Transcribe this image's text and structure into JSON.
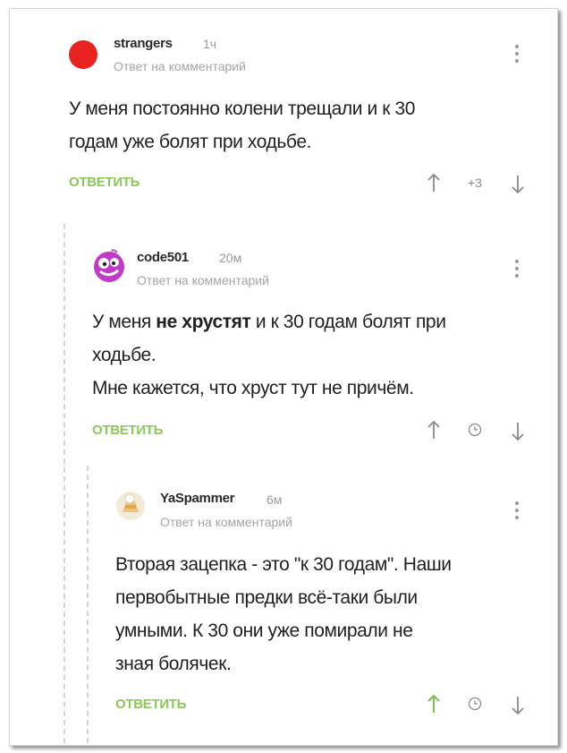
{
  "comments": [
    {
      "username": "strangers",
      "time": "1ч",
      "reply_to": "Ответ на комментарий",
      "text_lines": [
        "У меня постоянно колени трещали и к 30",
        "годам уже болят при ходьбе."
      ],
      "reply_label": "ОТВЕТИТЬ",
      "rating": "+3",
      "avatar_color": "#e8231f"
    },
    {
      "username": "code501",
      "time": "20м",
      "reply_to": "Ответ на комментарий",
      "text_parts": {
        "before": "У меня ",
        "bold": "не хрустят",
        "after": " и к 30 годам болят при",
        "line2": "ходьбе.",
        "line3": "Мне кажется, что хруст тут не причём."
      },
      "reply_label": "ОТВЕТИТЬ",
      "avatar_color": "#c13bc9"
    },
    {
      "username": "YaSpammer",
      "time": "6м",
      "reply_to": "Ответ на комментарий",
      "text_lines": [
        "Вторая зацепка - это \"к 30 годам\". Наши",
        "первобытные предки всё-таки были",
        "умными. К 30 они уже помирали не",
        "зная болячек."
      ],
      "reply_label": "ОТВЕТИТЬ",
      "upvoted_color": "#7cc24c"
    }
  ],
  "colors": {
    "accent_green": "#8ac858",
    "muted_text": "#a5a5a5",
    "icon_gray": "#8a8a8a"
  },
  "icons": [
    "menu-dots-icon",
    "arrow-up-icon",
    "arrow-down-icon",
    "clock-icon"
  ]
}
